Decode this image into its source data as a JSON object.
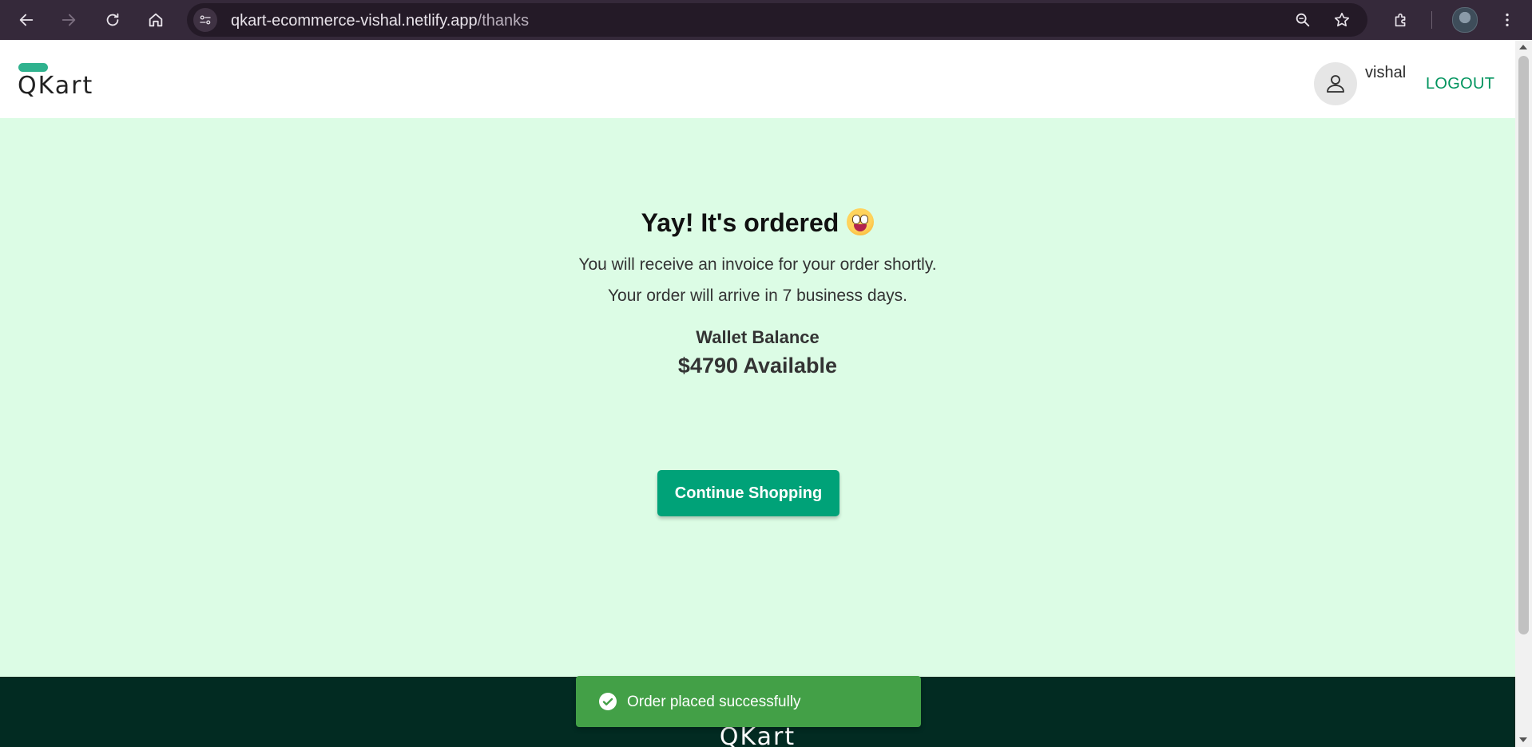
{
  "browser": {
    "url_host": "qkart-ecommerce-vishal.netlify.app",
    "url_path": "/thanks",
    "icons": [
      "back-arrow-icon",
      "forward-arrow-icon",
      "reload-icon",
      "home-icon",
      "site-info-icon",
      "zoom-icon",
      "star-icon",
      "extensions-icon",
      "profile-avatar",
      "more-menu-icon"
    ]
  },
  "header": {
    "logo": "QKart",
    "username": "vishal",
    "logout_label": "LOGOUT"
  },
  "main": {
    "title": "Yay! It's ordered",
    "invoice_text": "You will receive an invoice for your order shortly.",
    "arrival_text": "Your order will arrive in 7 business days.",
    "wallet_label": "Wallet Balance",
    "wallet_amount": "$4790 Available",
    "continue_label": "Continue Shopping"
  },
  "footer": {
    "logo": "QKart"
  },
  "snackbar": {
    "message": "Order placed successfully"
  },
  "colors": {
    "brand_green": "#00a278",
    "success_bg": "#dcfce5",
    "footer_bg": "#022b22",
    "snackbar_bg": "#43a047",
    "logout_text": "#00945e"
  }
}
